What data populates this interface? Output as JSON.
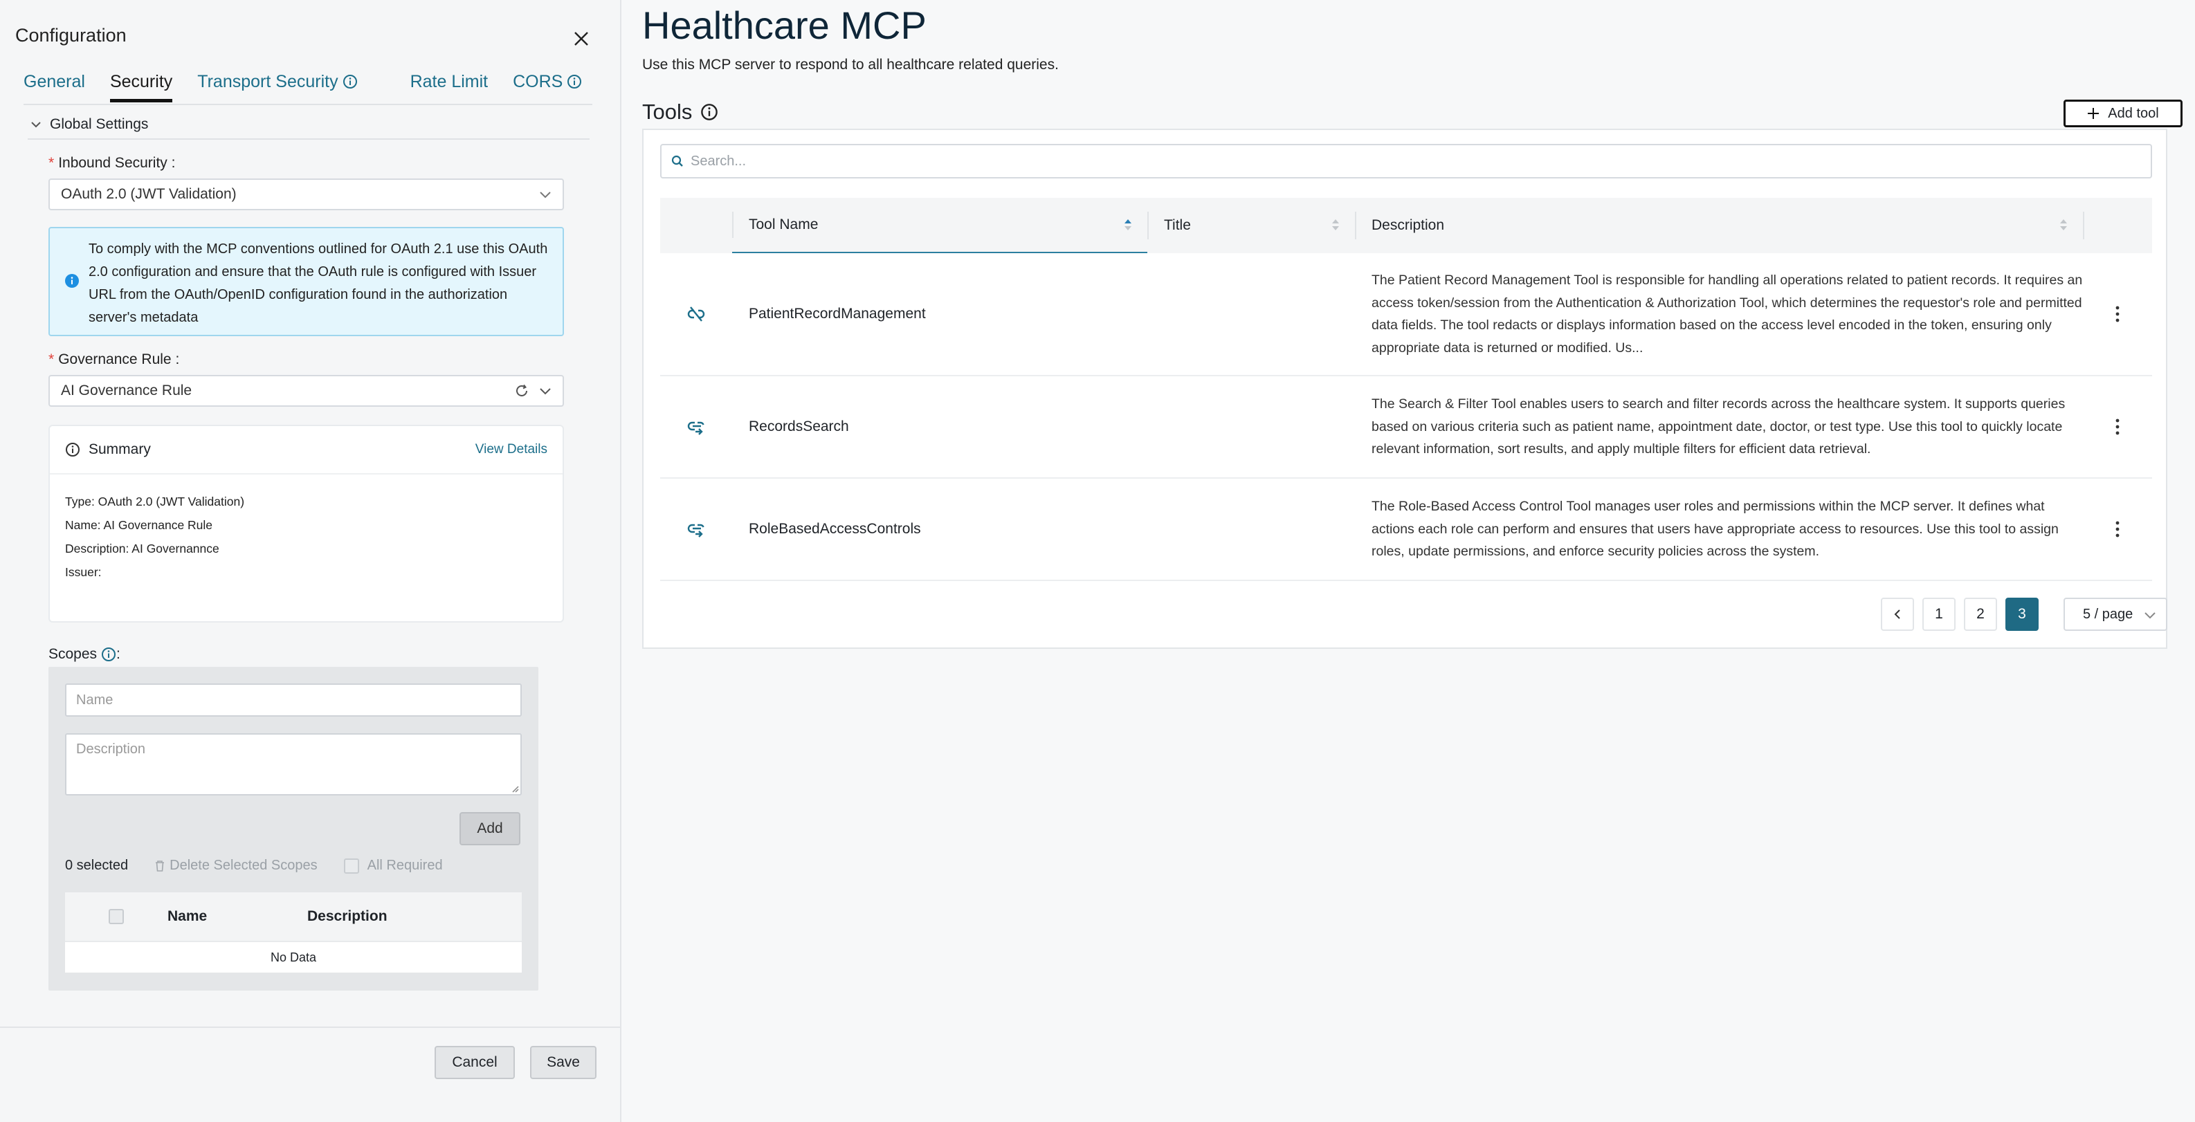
{
  "drawer": {
    "title": "Configuration",
    "tabs": [
      {
        "label": "General"
      },
      {
        "label": "Security"
      },
      {
        "label": "Transport Security"
      },
      {
        "label": "Rate Limit"
      },
      {
        "label": "CORS"
      }
    ],
    "section": "Global Settings",
    "inbound_label": "Inbound Security",
    "inbound_value": "OAuth 2.0 (JWT Validation)",
    "alert_text": "To comply with the MCP conventions outlined for OAuth 2.1 use this OAuth 2.0 configuration and ensure that the OAuth rule is configured with Issuer URL from the OAuth/OpenID configuration found in the authorization server's metadata",
    "governance_label": "Governance Rule",
    "governance_value": "AI Governance Rule",
    "summary": {
      "title": "Summary",
      "view_details": "View Details",
      "type": "Type: OAuth 2.0 (JWT Validation)",
      "name": "Name: AI Governance Rule",
      "description": "Description: AI Governannce",
      "issuer": "Issuer:"
    },
    "scopes": {
      "label": "Scopes",
      "name_placeholder": "Name",
      "desc_placeholder": "Description",
      "add": "Add",
      "selected": "0 selected",
      "delete": "Delete Selected Scopes",
      "all_required": "All Required",
      "col_name": "Name",
      "col_desc": "Description",
      "empty": "No Data"
    },
    "cancel": "Cancel",
    "save": "Save"
  },
  "main": {
    "title": "Healthcare MCP",
    "subtitle": "Use this MCP server to respond to all healthcare related queries.",
    "tools_label": "Tools",
    "add_tool": "Add tool",
    "search_placeholder": "Search...",
    "columns": {
      "name": "Tool Name",
      "title": "Title",
      "description": "Description"
    },
    "rows": [
      {
        "icon": "link-off-icon",
        "name": "PatientRecordManagement",
        "title": "",
        "description": "The Patient Record Management Tool is responsible for handling all operations related to patient records. It requires an access token/session from the Authentication & Authorization Tool, which determines the requestor's role and permitted data fields. The tool redacts or displays information based on the access level encoded in the token, ensuring only appropriate data is returned or modified. Us..."
      },
      {
        "icon": "link-arrow-icon",
        "name": "RecordsSearch",
        "title": "",
        "description": "The Search & Filter Tool enables users to search and filter records across the healthcare system. It supports queries based on various criteria such as patient name, appointment date, doctor, or test type. Use this tool to quickly locate relevant information, sort results, and apply multiple filters for efficient data retrieval."
      },
      {
        "icon": "link-arrow-icon",
        "name": "RoleBasedAccessControls",
        "title": "",
        "description": "The Role-Based Access Control Tool manages user roles and permissions within the MCP server. It defines what actions each role can perform and ensures that users have appropriate access to resources. Use this tool to assign roles, update permissions, and enforce security policies across the system."
      }
    ],
    "pagination": {
      "pages": [
        "1",
        "2",
        "3"
      ],
      "current": "3",
      "per_page": "5 / page"
    }
  }
}
